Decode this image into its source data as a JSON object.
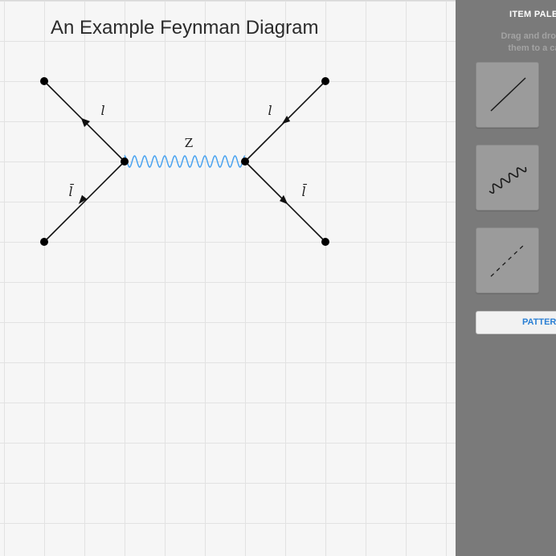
{
  "canvas": {
    "title": "An Example Feynman Diagram",
    "labels": {
      "top_left": "l",
      "top_right": "l",
      "bottom_left": "l̄",
      "bottom_right": "l̄",
      "propagator": "Z"
    },
    "colors": {
      "fermion_line": "#111111",
      "boson_line": "#4aa3f0",
      "vertex": "#000000"
    }
  },
  "palette": {
    "title": "ITEM PALETTE",
    "instructions_line1": "Drag and drop items",
    "instructions_line2": "them to a canvas",
    "items": [
      {
        "name": "fermion-line-item",
        "icon": "solid-line-icon"
      },
      {
        "name": "gauge-boson-item",
        "icon": "wavy-line-icon"
      },
      {
        "name": "scalar-line-item",
        "icon": "dashed-line-icon"
      }
    ],
    "patterns_label": "PATTERNS",
    "colors": {
      "background": "#7a7a7a",
      "button_text": "#2a7fd4"
    }
  }
}
